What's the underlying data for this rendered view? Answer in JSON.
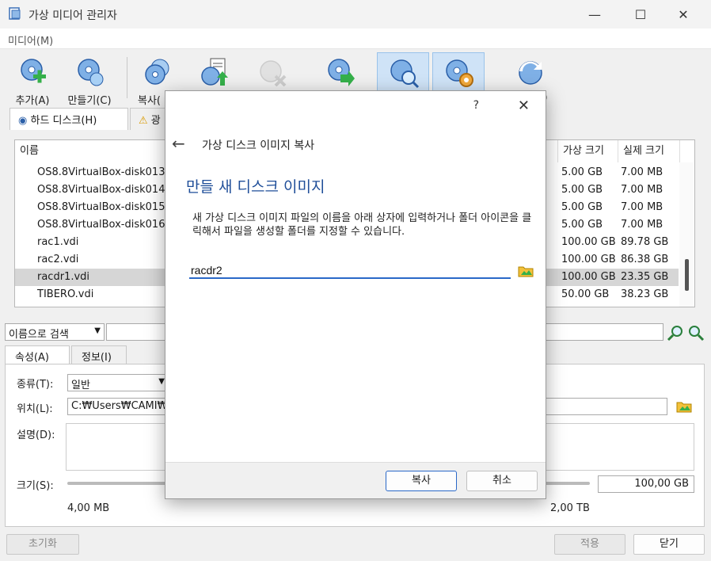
{
  "window": {
    "title": "가상 미디어 관리자",
    "minimize": "—",
    "maximize": "☐",
    "close": "✕"
  },
  "menu": {
    "media": "미디어(M)"
  },
  "toolbar": {
    "add": "추가(A)",
    "create": "만들기(C)",
    "copy": "복사(",
    "refresh": "(F)"
  },
  "tabs": {
    "hard_disks": "하드 디스크(H)",
    "optical": "광"
  },
  "list": {
    "headers": {
      "name": "이름",
      "virtual_size": "가상 크기",
      "actual_size": "실제 크기"
    },
    "rows": [
      {
        "name": "OS8.8VirtualBox-disk013",
        "vsize": "5.00 GB",
        "asize": "7.00 MB"
      },
      {
        "name": "OS8.8VirtualBox-disk014",
        "vsize": "5.00 GB",
        "asize": "7.00 MB"
      },
      {
        "name": "OS8.8VirtualBox-disk015",
        "vsize": "5.00 GB",
        "asize": "7.00 MB"
      },
      {
        "name": "OS8.8VirtualBox-disk016",
        "vsize": "5.00 GB",
        "asize": "7.00 MB"
      },
      {
        "name": "rac1.vdi",
        "vsize": "100.00 GB",
        "asize": "89.78 GB"
      },
      {
        "name": "rac2.vdi",
        "vsize": "100.00 GB",
        "asize": "86.38 GB"
      },
      {
        "name": "racdr1.vdi",
        "vsize": "100.00 GB",
        "asize": "23.35 GB"
      },
      {
        "name": "TIBERO.vdi",
        "vsize": "50.00 GB",
        "asize": "38.23 GB"
      }
    ]
  },
  "search": {
    "mode": "이름으로 검색"
  },
  "bottom_tabs": {
    "attributes": "속성(A)",
    "info": "정보(I)"
  },
  "attributes": {
    "type_label": "종류(T):",
    "type_value": "일반",
    "location_label": "위치(L):",
    "location_value": "C:₩Users₩CAMI₩",
    "description_label": "설명(D):",
    "size_label": "크기(S):",
    "size_value": "100,00 GB",
    "size_min": "4,00 MB",
    "size_max": "2,00 TB"
  },
  "footer": {
    "reset": "초기화",
    "apply": "적용",
    "close": "닫기"
  },
  "dialog": {
    "help": "?",
    "close": "✕",
    "back": "←",
    "title": "가상 디스크 이미지 복사",
    "section": "만들 새 디스크 이미지",
    "description": "새 가상 디스크 이미지 파일의 이름을 아래 상자에 입력하거나 폴더 아이콘을 클릭해서 파일을 생성할 폴더를 지정할 수 있습니다.",
    "filename": "racdr2",
    "copy_button": "복사",
    "cancel_button": "취소"
  }
}
